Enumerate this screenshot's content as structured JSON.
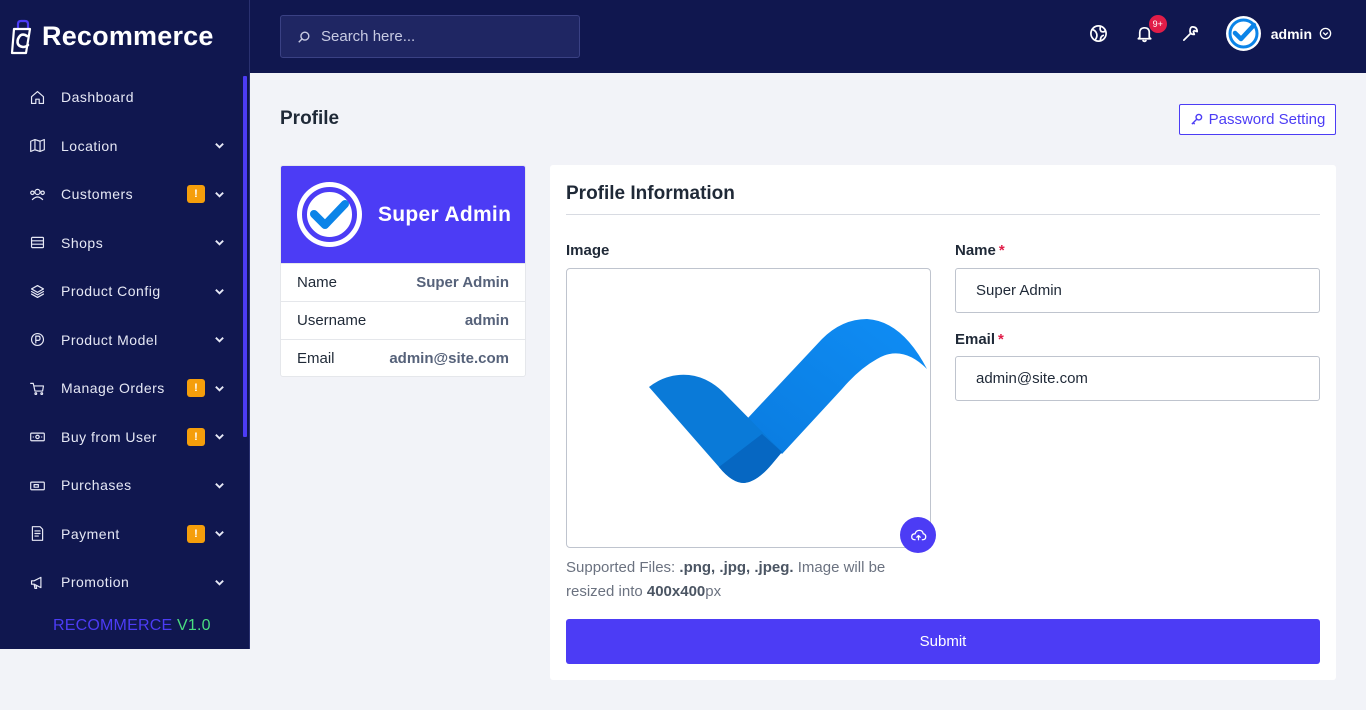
{
  "brand": {
    "name": "Recommerce"
  },
  "sidebar": {
    "items": [
      {
        "label": "Dashboard",
        "icon": "home-icon",
        "badge": "",
        "chevron": false
      },
      {
        "label": "Location",
        "icon": "map-icon",
        "badge": "",
        "chevron": true
      },
      {
        "label": "Customers",
        "icon": "users-icon",
        "badge": "!",
        "chevron": true
      },
      {
        "label": "Shops",
        "icon": "store-icon",
        "badge": "",
        "chevron": true
      },
      {
        "label": "Product Config",
        "icon": "layers-icon",
        "badge": "",
        "chevron": true
      },
      {
        "label": "Product Model",
        "icon": "product-model-icon",
        "badge": "",
        "chevron": true
      },
      {
        "label": "Manage Orders",
        "icon": "cart-icon",
        "badge": "!",
        "chevron": true
      },
      {
        "label": "Buy from User",
        "icon": "cash-icon",
        "badge": "!",
        "chevron": true
      },
      {
        "label": "Purchases",
        "icon": "purchase-icon",
        "badge": "",
        "chevron": true
      },
      {
        "label": "Payment",
        "icon": "invoice-icon",
        "badge": "!",
        "chevron": true
      },
      {
        "label": "Promotion",
        "icon": "megaphone-icon",
        "badge": "",
        "chevron": true
      }
    ],
    "version_brand": "RECOMMERCE",
    "version_number": "V1.0"
  },
  "topbar": {
    "search_placeholder": "Search here...",
    "notification_count": "9+",
    "username": "admin"
  },
  "page": {
    "title": "Profile",
    "password_button": "Password Setting"
  },
  "profile_card": {
    "display_name": "Super Admin",
    "rows": [
      {
        "key": "Name",
        "value": "Super Admin"
      },
      {
        "key": "Username",
        "value": "admin"
      },
      {
        "key": "Email",
        "value": "admin@site.com"
      }
    ]
  },
  "profile_info": {
    "title": "Profile Information",
    "image_label": "Image",
    "help": {
      "prefix": "Supported Files: ",
      "formats": ".png, .jpg, .jpeg.",
      "middle": " Image will be resized into ",
      "size": "400x400",
      "suffix": "px"
    },
    "name_label": "Name",
    "name_value": "Super Admin",
    "email_label": "Email",
    "email_value": "admin@site.com",
    "required_mark": "*",
    "submit_label": "Submit"
  },
  "colors": {
    "sidebar_bg": "#10174f",
    "accent": "#4c3cf5",
    "badge": "#f59e0b",
    "notification": "#e11d48",
    "version_green": "#4ade80",
    "check_blue": "#0b84e8"
  }
}
